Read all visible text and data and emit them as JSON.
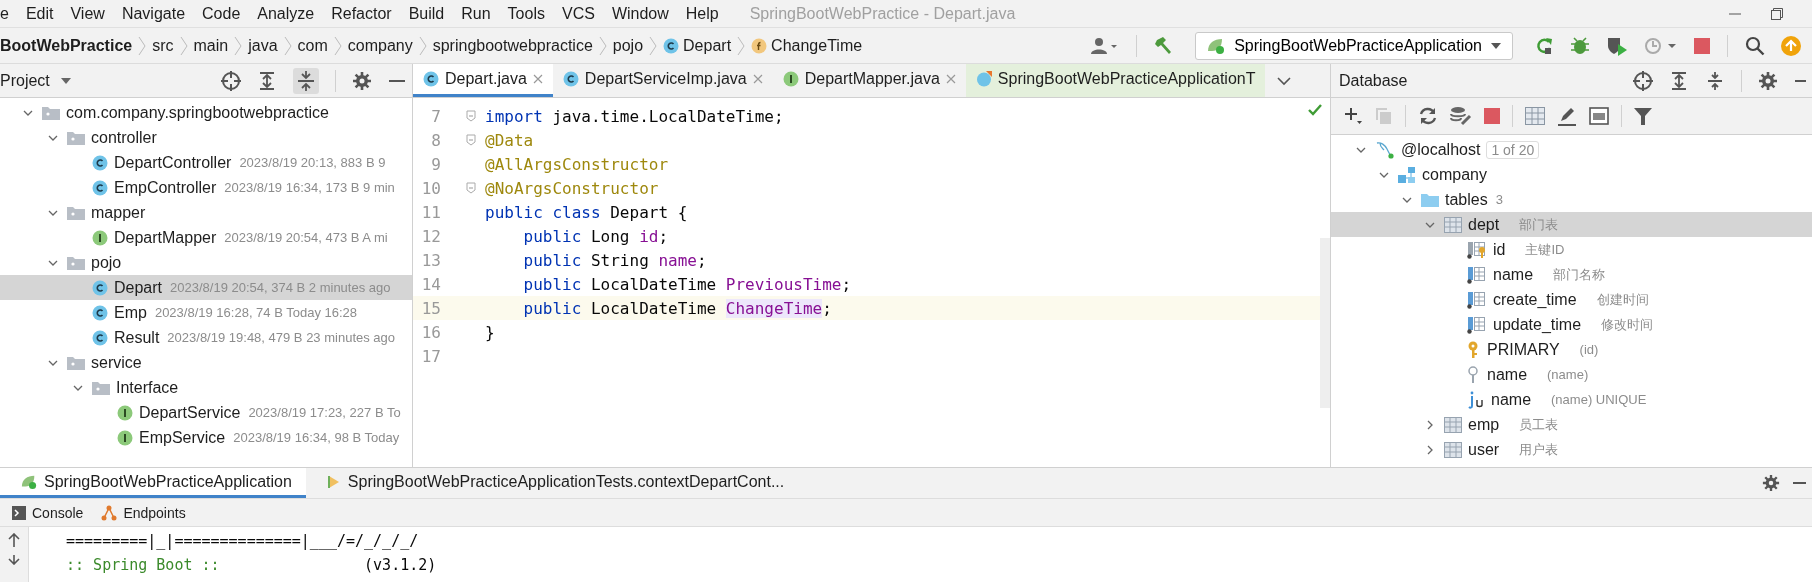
{
  "window": {
    "title": "SpringBootWebPractice - Depart.java"
  },
  "menu": [
    "e",
    "Edit",
    "View",
    "Navigate",
    "Code",
    "Analyze",
    "Refactor",
    "Build",
    "Run",
    "Tools",
    "VCS",
    "Window",
    "Help"
  ],
  "breadcrumbs": [
    {
      "label": "BootWebPractice",
      "kind": "project"
    },
    {
      "label": "src",
      "kind": "folder"
    },
    {
      "label": "main",
      "kind": "folder"
    },
    {
      "label": "java",
      "kind": "folder"
    },
    {
      "label": "com",
      "kind": "folder"
    },
    {
      "label": "company",
      "kind": "folder"
    },
    {
      "label": "springbootwebpractice",
      "kind": "folder"
    },
    {
      "label": "pojo",
      "kind": "folder"
    },
    {
      "label": "Depart",
      "kind": "class"
    },
    {
      "label": "ChangeTime",
      "kind": "field"
    }
  ],
  "toolbar": {
    "run_config": "SpringBootWebPracticeApplication"
  },
  "project": {
    "title": "Project",
    "tree": [
      {
        "name": "com.company.springbootwebpractice",
        "kind": "package",
        "expanded": true,
        "selected": false,
        "children": [
          {
            "name": "controller",
            "kind": "package",
            "expanded": true,
            "selected": false,
            "children": [
              {
                "name": "DepartController",
                "meta": "2023/8/19 20:13, 883 B 9",
                "kind": "class",
                "selected": false
              },
              {
                "name": "EmpController",
                "meta": "2023/8/19 16:34, 173 B 9 min",
                "kind": "class",
                "selected": false
              }
            ]
          },
          {
            "name": "mapper",
            "kind": "package",
            "expanded": true,
            "selected": false,
            "children": [
              {
                "name": "DepartMapper",
                "meta": "2023/8/19 20:54, 473 B A mi",
                "kind": "interface",
                "selected": false
              }
            ]
          },
          {
            "name": "pojo",
            "kind": "package",
            "expanded": true,
            "selected": false,
            "children": [
              {
                "name": "Depart",
                "meta": "2023/8/19 20:54, 374 B 2 minutes ago",
                "kind": "class",
                "selected": true
              },
              {
                "name": "Emp",
                "meta": "2023/8/19 16:28, 74 B Today 16:28",
                "kind": "class",
                "selected": false
              },
              {
                "name": "Result",
                "meta": "2023/8/19 19:48, 479 B 23 minutes ago",
                "kind": "class",
                "selected": false
              }
            ]
          },
          {
            "name": "service",
            "kind": "package",
            "expanded": true,
            "selected": false,
            "children": [
              {
                "name": "Interface",
                "kind": "package",
                "expanded": true,
                "selected": false,
                "children": [
                  {
                    "name": "DepartService",
                    "meta": "2023/8/19 17:23, 227 B To",
                    "kind": "interface",
                    "selected": false
                  },
                  {
                    "name": "EmpService",
                    "meta": "2023/8/19 16:34, 98 B Today",
                    "kind": "interface",
                    "selected": false
                  }
                ]
              }
            ]
          }
        ]
      }
    ]
  },
  "editor": {
    "tabs": [
      {
        "label": "Depart.java",
        "kind": "class",
        "selected": true,
        "closable": true
      },
      {
        "label": "DepartServiceImp.java",
        "kind": "class",
        "selected": false,
        "closable": true
      },
      {
        "label": "DepartMapper.java",
        "kind": "interface",
        "selected": false,
        "closable": true
      },
      {
        "label": "SpringBootWebPracticeApplicationT",
        "kind": "test",
        "selected": false,
        "closable": false
      }
    ],
    "lines": [
      {
        "number": "7",
        "fold": true,
        "current": false,
        "tokens": [
          {
            "text": "import",
            "kind": "keyword"
          },
          {
            "text": " java.time.LocalDateTime;",
            "kind": "plain"
          }
        ]
      },
      {
        "number": "8",
        "fold": true,
        "current": false,
        "tokens": [
          {
            "text": "@Data",
            "kind": "annotation"
          }
        ]
      },
      {
        "number": "9",
        "fold": false,
        "current": false,
        "tokens": [
          {
            "text": "@AllArgsConstructor",
            "kind": "annotation"
          }
        ]
      },
      {
        "number": "10",
        "fold": true,
        "current": false,
        "tokens": [
          {
            "text": "@NoArgsConstructor",
            "kind": "annotation"
          }
        ]
      },
      {
        "number": "11",
        "fold": false,
        "current": false,
        "tokens": [
          {
            "text": "public class",
            "kind": "keyword"
          },
          {
            "text": " Depart {",
            "kind": "plain"
          }
        ]
      },
      {
        "number": "12",
        "fold": false,
        "current": false,
        "tokens": [
          {
            "text": "    public",
            "kind": "keyword"
          },
          {
            "text": " Long ",
            "kind": "plain"
          },
          {
            "text": "id",
            "kind": "field"
          },
          {
            "text": ";",
            "kind": "plain"
          }
        ]
      },
      {
        "number": "13",
        "fold": false,
        "current": false,
        "tokens": [
          {
            "text": "    public",
            "kind": "keyword"
          },
          {
            "text": " String ",
            "kind": "plain"
          },
          {
            "text": "name",
            "kind": "field"
          },
          {
            "text": ";",
            "kind": "plain"
          }
        ]
      },
      {
        "number": "14",
        "fold": false,
        "current": false,
        "tokens": [
          {
            "text": "    public",
            "kind": "keyword"
          },
          {
            "text": " LocalDateTime ",
            "kind": "plain"
          },
          {
            "text": "PreviousTime",
            "kind": "field"
          },
          {
            "text": ";",
            "kind": "plain"
          }
        ]
      },
      {
        "number": "15",
        "fold": false,
        "current": true,
        "tokens": [
          {
            "text": "    public",
            "kind": "keyword"
          },
          {
            "text": " LocalDateTime ",
            "kind": "plain"
          },
          {
            "text": "ChangeTime",
            "kind": "usage"
          },
          {
            "text": ";",
            "kind": "plain"
          }
        ]
      },
      {
        "number": "16",
        "fold": false,
        "current": false,
        "tokens": [
          {
            "text": "}",
            "kind": "plain"
          }
        ]
      },
      {
        "number": "17",
        "fold": false,
        "current": false
      }
    ]
  },
  "database": {
    "title": "Database",
    "tree": [
      {
        "name": "@localhost",
        "kind": "datasource",
        "badge": "1 of 20",
        "expanded": true,
        "selected": false,
        "children": [
          {
            "name": "company",
            "kind": "schema",
            "expanded": true,
            "selected": false,
            "children": [
              {
                "name": "tables",
                "kind": "folder",
                "count": "3",
                "expanded": true,
                "selected": false,
                "children": [
                  {
                    "name": "dept",
                    "kind": "table",
                    "comment": "部门表",
                    "expanded": true,
                    "selected": true,
                    "children": [
                      {
                        "name": "id",
                        "kind": "key-column",
                        "comment": "主键ID",
                        "selected": false
                      },
                      {
                        "name": "name",
                        "kind": "column",
                        "comment": "部门名称",
                        "selected": false
                      },
                      {
                        "name": "create_time",
                        "kind": "column",
                        "comment": "创建时间",
                        "selected": false
                      },
                      {
                        "name": "update_time",
                        "kind": "column",
                        "comment": "修改时间",
                        "selected": false
                      },
                      {
                        "name": "PRIMARY",
                        "kind": "primary-key",
                        "comment": "(id)",
                        "selected": false
                      },
                      {
                        "name": "name",
                        "kind": "index",
                        "comment": "(name)",
                        "selected": false
                      },
                      {
                        "name": "name",
                        "kind": "unique-index",
                        "comment": "(name) UNIQUE",
                        "selected": false
                      }
                    ]
                  },
                  {
                    "name": "emp",
                    "kind": "table",
                    "comment": "员工表",
                    "expanded": false,
                    "selected": false
                  },
                  {
                    "name": "user",
                    "kind": "table",
                    "comment": "用户表",
                    "expanded": false,
                    "selected": false
                  }
                ]
              }
            ]
          }
        ]
      }
    ]
  },
  "run": {
    "tabs": [
      {
        "label": "SpringBootWebPracticeApplication",
        "kind": "app",
        "selected": true
      },
      {
        "label": "SpringBootWebPracticeApplicationTests.contextDepartCont...",
        "kind": "test",
        "selected": false
      }
    ],
    "subtabs": [
      {
        "label": "Console",
        "kind": "console"
      },
      {
        "label": "Endpoints",
        "kind": "endpoints"
      }
    ],
    "console": [
      {
        "kind": "plain",
        "text": " =========|_|==============|___/=/_/_/_/"
      },
      {
        "kind": "boot",
        "text": " :: Spring Boot :: ",
        "extra": "               (v3.1.2)"
      }
    ]
  }
}
